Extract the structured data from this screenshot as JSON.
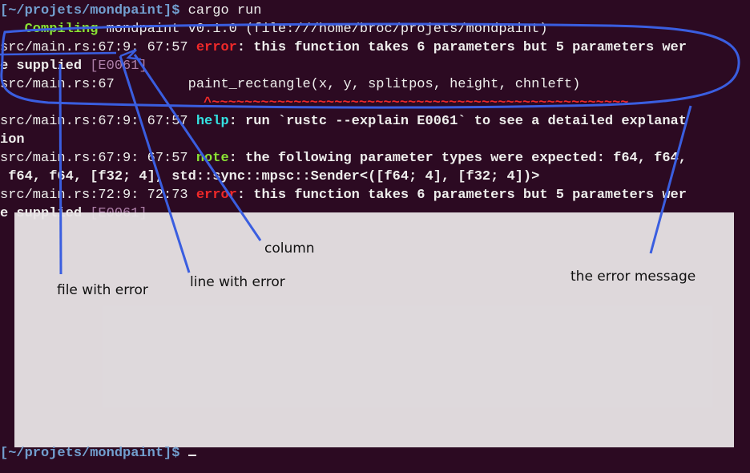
{
  "terminal": {
    "prompt_path": "[~/projets/mondpaint]$",
    "command": "cargo run",
    "compiling_word": "Compiling",
    "compiling_rest": "mondpaint v0.1.0 (file:///home/broc/projets/mondpaint)",
    "err1_loc": "src/main.rs:67:9: 67:57",
    "error_word": "error",
    "err1_msg_a": ": this function takes 6 parameters but 5 parameters wer",
    "err1_msg_b": "e supplied",
    "err_code": "[E0061]",
    "src_loc": "src/main.rs:67",
    "src_code": "paint_rectangle(x, y, splitpos, height, chnleft)",
    "underline": "^~~~~~~~~~~~~~~~~~~~~~~~~~~~~~~~~~~~~~~~~~~~~~~~~~~~",
    "help_loc": "src/main.rs:67:9: 67:57",
    "help_word": "help",
    "help_msg_a": ": run `rustc --explain E0061` to see a detailed explanat",
    "help_msg_b": "ion",
    "note_loc": "src/main.rs:67:9: 67:57",
    "note_word": "note",
    "note_msg_a": ": the following parameter types were expected: f64, f64,",
    "note_msg_b": " f64, f64, [f32; 4], std::sync::mpsc::Sender<([f64; 4], [f32; 4])>",
    "err2_loc": "src/main.rs:72:9: 72:73",
    "err2_msg_a": ": this function takes 6 parameters but 5 parameters wer",
    "err2_msg_b": "e supplied",
    "final_prompt": "[~/projets/mondpaint]$"
  },
  "annotations": {
    "file_label": "file with error",
    "line_label": "line with error",
    "column_label": "column",
    "message_label": "the error message"
  },
  "colors": {
    "background": "#2c0a22",
    "annotation_blue": "#3a5ee0",
    "error_red": "#ef2929",
    "ok_green": "#8ae234",
    "help_cyan": "#34e2e2"
  }
}
